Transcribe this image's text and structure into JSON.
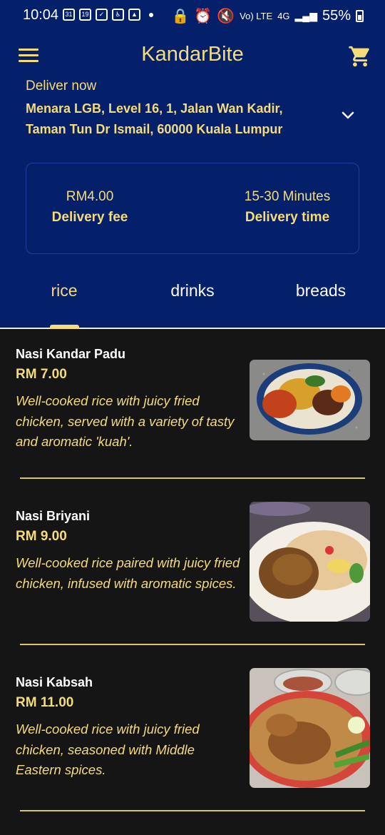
{
  "status_bar": {
    "time": "10:04",
    "network_volte": "Vo) LTE",
    "network_4g": "4G",
    "battery": "55%"
  },
  "app": {
    "title": "KandarBite",
    "accent_color": "#f4dc7a",
    "header_color": "#04206a",
    "icons": [
      "menu-icon",
      "cart-icon",
      "chevron-down-icon"
    ]
  },
  "delivery": {
    "mode": "Deliver now",
    "address_line1": "Menara LGB, Level 16, 1, Jalan Wan Kadir,",
    "address_line2": "Taman Tun Dr Ismail, 60000 Kuala Lumpur",
    "fee_value": "RM4.00",
    "fee_label": "Delivery fee",
    "time_value": "15-30 Minutes",
    "time_label": "Delivery time"
  },
  "tabs": [
    {
      "label": "rice",
      "active": true
    },
    {
      "label": "drinks",
      "active": false
    },
    {
      "label": "breads",
      "active": false
    }
  ],
  "menu": [
    {
      "name": "Nasi Kandar Padu",
      "price": "RM 7.00",
      "desc": "Well-cooked rice with juicy fried chicken, served with a variety of tasty and aromatic 'kuah'."
    },
    {
      "name": "Nasi Briyani",
      "price": "RM 9.00",
      "desc": "Well-cooked rice paired with juicy fried chicken, infused with aromatic spices."
    },
    {
      "name": "Nasi Kabsah",
      "price": "RM 11.00",
      "desc": "Well-cooked rice with juicy fried chicken, seasoned with Middle Eastern spices."
    }
  ]
}
